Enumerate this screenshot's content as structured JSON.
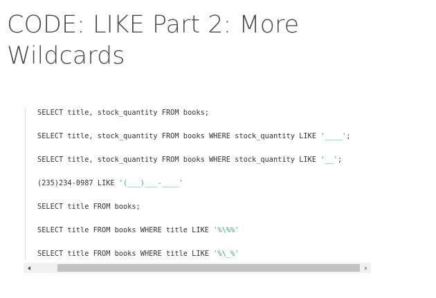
{
  "page": {
    "title": "CODE: LIKE Part 2: More Wildcards"
  },
  "code_block": {
    "lines": [
      {
        "code": "SELECT title, stock_quantity FROM books;",
        "string": "",
        "end": ""
      },
      {
        "code": "SELECT title, stock_quantity FROM books WHERE stock_quantity LIKE ",
        "string": "'____'",
        "end": ";"
      },
      {
        "code": "SELECT title, stock_quantity FROM books WHERE stock_quantity LIKE ",
        "string": "'__'",
        "end": ";"
      },
      {
        "code": "(235)234-0987 LIKE ",
        "string": "'(___)___-____'",
        "end": ""
      },
      {
        "code": "SELECT title FROM books;",
        "string": "",
        "end": ""
      },
      {
        "code": "SELECT title FROM books WHERE title LIKE ",
        "string": "'%\\%%'",
        "end": ""
      },
      {
        "code": "SELECT title FROM books WHERE title LIKE ",
        "string": "'%\\_%'",
        "end": ""
      }
    ],
    "string_color": "#3aa57a"
  },
  "scrollbar": {
    "left_icon": "scroll-left-arrow",
    "right_icon": "scroll-right-arrow"
  }
}
